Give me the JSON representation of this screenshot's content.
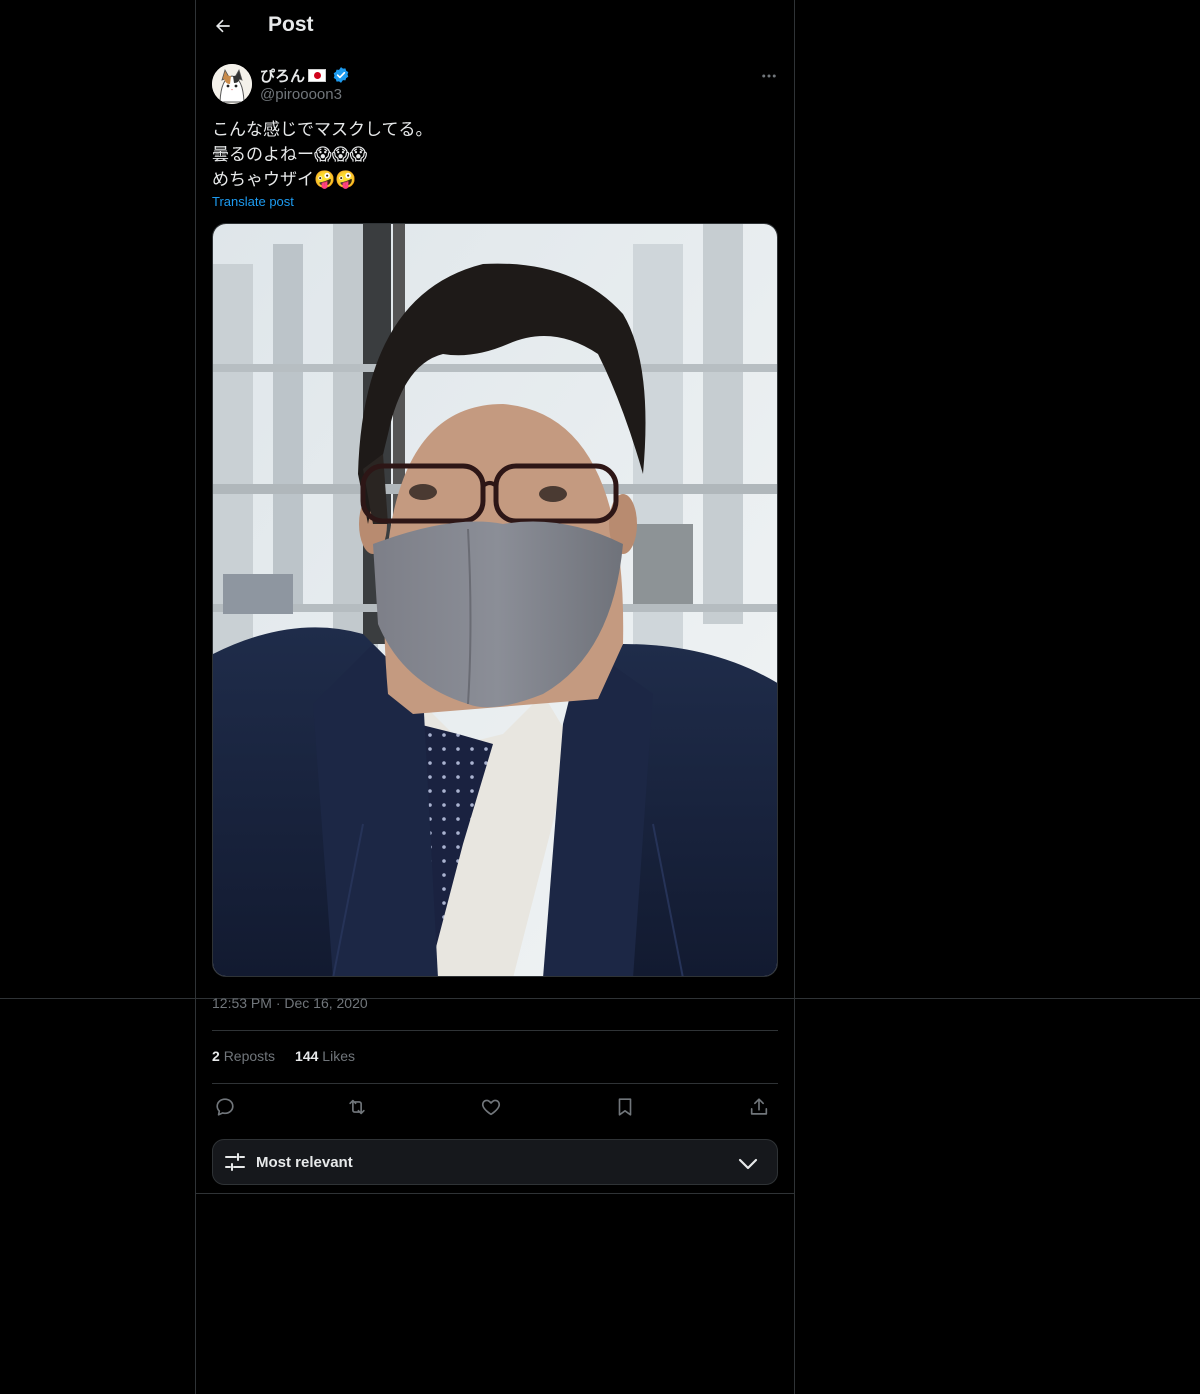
{
  "header": {
    "title": "Post",
    "back_icon": "arrow-left-icon"
  },
  "author": {
    "name": "ぴろん",
    "flag_icon": "japan-flag-icon",
    "verified_icon": "verified-badge-icon",
    "handle": "@piroooon3"
  },
  "post": {
    "lines": [
      "こんな感じでマスクしてる。",
      "曇るのよねー😱😱😱",
      "めちゃウザイ🤪🤪"
    ],
    "translate_label": "Translate post",
    "timestamp": "12:53 PM · Dec 16, 2020"
  },
  "stats": {
    "reposts_count": "2",
    "reposts_label": "Reposts",
    "likes_count": "144",
    "likes_label": "Likes"
  },
  "actions": [
    "reply-icon",
    "repost-icon",
    "like-icon",
    "bookmark-icon",
    "share-icon"
  ],
  "sort": {
    "label": "Most relevant",
    "icon": "sliders-icon",
    "chevron": "chevron-down-icon"
  },
  "colors": {
    "accent": "#1d9bf0",
    "muted": "#71767b",
    "border": "#2f3336",
    "text": "#e7e9ea"
  }
}
